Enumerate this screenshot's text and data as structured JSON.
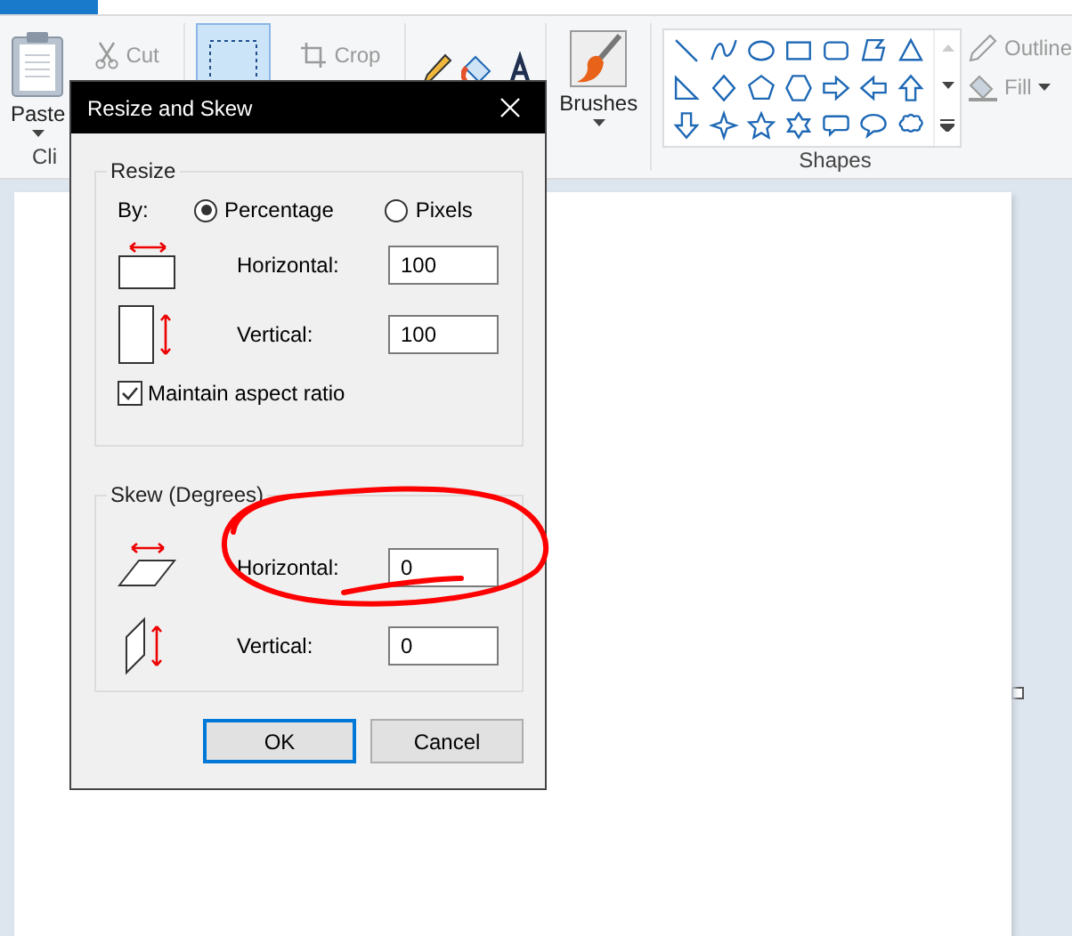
{
  "ribbon": {
    "paste_label": "Paste",
    "cut_label": "Cut",
    "clipboard_group_label": "Cli",
    "crop_label": "Crop",
    "brushes_label": "Brushes",
    "shapes_label": "Shapes",
    "outline_label": "Outline",
    "fill_label": "Fill"
  },
  "dialog": {
    "title": "Resize and Skew",
    "resize": {
      "legend": "Resize",
      "by_label": "By:",
      "options": [
        {
          "label": "Percentage",
          "selected": true
        },
        {
          "label": "Pixels",
          "selected": false
        }
      ],
      "fields": [
        {
          "kind": "horizontal",
          "label": "Horizontal:",
          "value": "100"
        },
        {
          "kind": "vertical",
          "label": "Vertical:",
          "value": "100"
        }
      ],
      "maintain": {
        "label": "Maintain aspect ratio",
        "checked": true
      }
    },
    "skew": {
      "legend": "Skew (Degrees)",
      "fields": [
        {
          "kind": "horizontal",
          "label": "Horizontal:",
          "value": "0"
        },
        {
          "kind": "vertical",
          "label": "Vertical:",
          "value": "0"
        }
      ]
    },
    "buttons": [
      {
        "label": "OK",
        "default": true
      },
      {
        "label": "Cancel",
        "default": false
      }
    ]
  }
}
